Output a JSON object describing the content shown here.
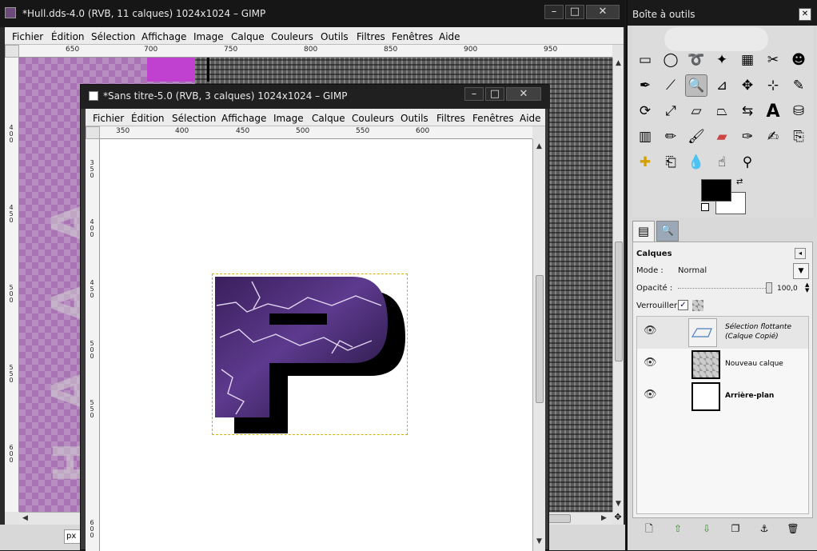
{
  "window1": {
    "title": "*Hull.dds-4.0 (RVB, 11 calques) 1024x1024 – GIMP",
    "menu": [
      "Fichier",
      "Édition",
      "Sélection",
      "Affichage",
      "Image",
      "Calque",
      "Couleurs",
      "Outils",
      "Filtres",
      "Fenêtres",
      "Aide"
    ],
    "ruler_ticks": [
      "650",
      "700",
      "750",
      "800",
      "850",
      "900",
      "950"
    ],
    "vruler_ticks": [
      "400",
      "450",
      "500",
      "550",
      "600"
    ],
    "unit": "px"
  },
  "window2": {
    "title": "*Sans titre-5.0 (RVB, 3 calques) 1024x1024 – GIMP",
    "menu": [
      "Fichier",
      "Édition",
      "Sélection",
      "Affichage",
      "Image",
      "Calque",
      "Couleurs",
      "Outils",
      "Filtres",
      "Fenêtres",
      "Aide"
    ],
    "ruler_ticks": [
      "350",
      "400",
      "450",
      "500",
      "550",
      "600"
    ],
    "vruler_ticks": [
      "350",
      "400",
      "450",
      "500",
      "550",
      "600"
    ]
  },
  "toolbox": {
    "title": "Boîte à outils",
    "tools": [
      "rect-select-icon",
      "ellipse-select-icon",
      "lasso-icon",
      "fuzzy-select-icon",
      "color-select-icon",
      "scissors-icon",
      "foreground-select-icon",
      "paths-icon",
      "color-picker-icon",
      "zoom-icon",
      "measure-icon",
      "move-icon",
      "align-icon",
      "crop-icon",
      "rotate-icon",
      "scale-icon",
      "shear-icon",
      "perspective-icon",
      "flip-icon",
      "text-icon",
      "bucket-fill-icon",
      "blend-icon",
      "pencil-icon",
      "paintbrush-icon",
      "eraser-icon",
      "airbrush-icon",
      "ink-icon",
      "clone-icon",
      "heal-icon",
      "perspective-clone-icon",
      "blur-icon",
      "smudge-icon",
      "dodge-burn-icon"
    ],
    "active_tool": "zoom-icon",
    "fg_color": "#000000",
    "bg_color": "#ffffff"
  },
  "layers": {
    "header": "Calques",
    "mode_label": "Mode :",
    "mode_value": "Normal",
    "opacity_label": "Opacité :",
    "opacity_value": "100,0",
    "lock_label": "Verrouiller :",
    "items": [
      {
        "name_line1": "Sélection flottante",
        "name_line2": "(Calque Copié)"
      },
      {
        "name": "Nouveau calque"
      },
      {
        "name": "Arrière-plan"
      }
    ]
  }
}
